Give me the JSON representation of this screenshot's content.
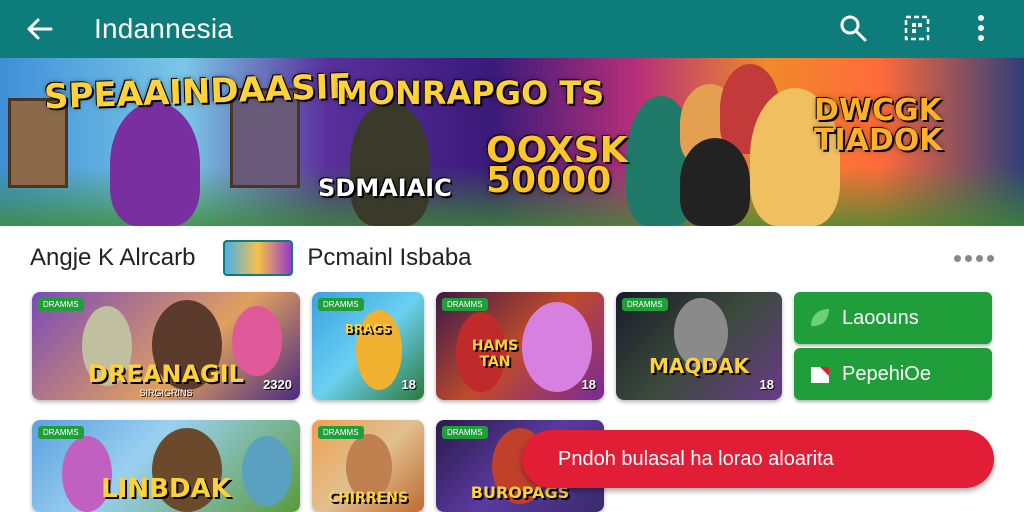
{
  "appbar": {
    "title": "Indannesia",
    "back_icon": "back-arrow-icon",
    "search_icon": "search-icon",
    "grid_icon": "grid-icon",
    "menu_icon": "more-vert-icon",
    "color": "#0e7c7b"
  },
  "banner": {
    "texts": [
      "SPEAAINDAASIE",
      "MONRAPGO TS",
      "OOXSK 50000",
      "SDMAIAIC",
      "DWCGK TIADOK"
    ]
  },
  "section": {
    "label": "Angje K Alrcarb",
    "label2": "Pcmainl Isbaba"
  },
  "cards": [
    {
      "tag": "DRAMMS",
      "title": "DREANAGIL",
      "sub": "SIRGIGRINS",
      "num": "2320"
    },
    {
      "tag": "DRAMMS",
      "title": "BRAGS",
      "sub": "",
      "num": "18"
    },
    {
      "tag": "DRAMMS",
      "title": "HAMS TAN",
      "sub": "",
      "num": "18"
    },
    {
      "tag": "DRAMMS",
      "title": "MAQDAK",
      "sub": "",
      "num": "18"
    },
    {
      "tag": "DRAMMS",
      "title": "LINBDAK",
      "sub": "",
      "num": ""
    },
    {
      "tag": "DRAMMS",
      "title": "CHIRRENS",
      "sub": "",
      "num": ""
    },
    {
      "tag": "DRAMMS",
      "title": "BUROPAGS",
      "sub": "",
      "num": ""
    }
  ],
  "buttons": {
    "b1": "Laoouns",
    "b2": "PepehiOe"
  },
  "toast": {
    "text": "Pndoh bulasal ha lorao aloarita"
  },
  "colors": {
    "accent_green": "#1f9e3a",
    "toast_red": "#e21e36"
  }
}
